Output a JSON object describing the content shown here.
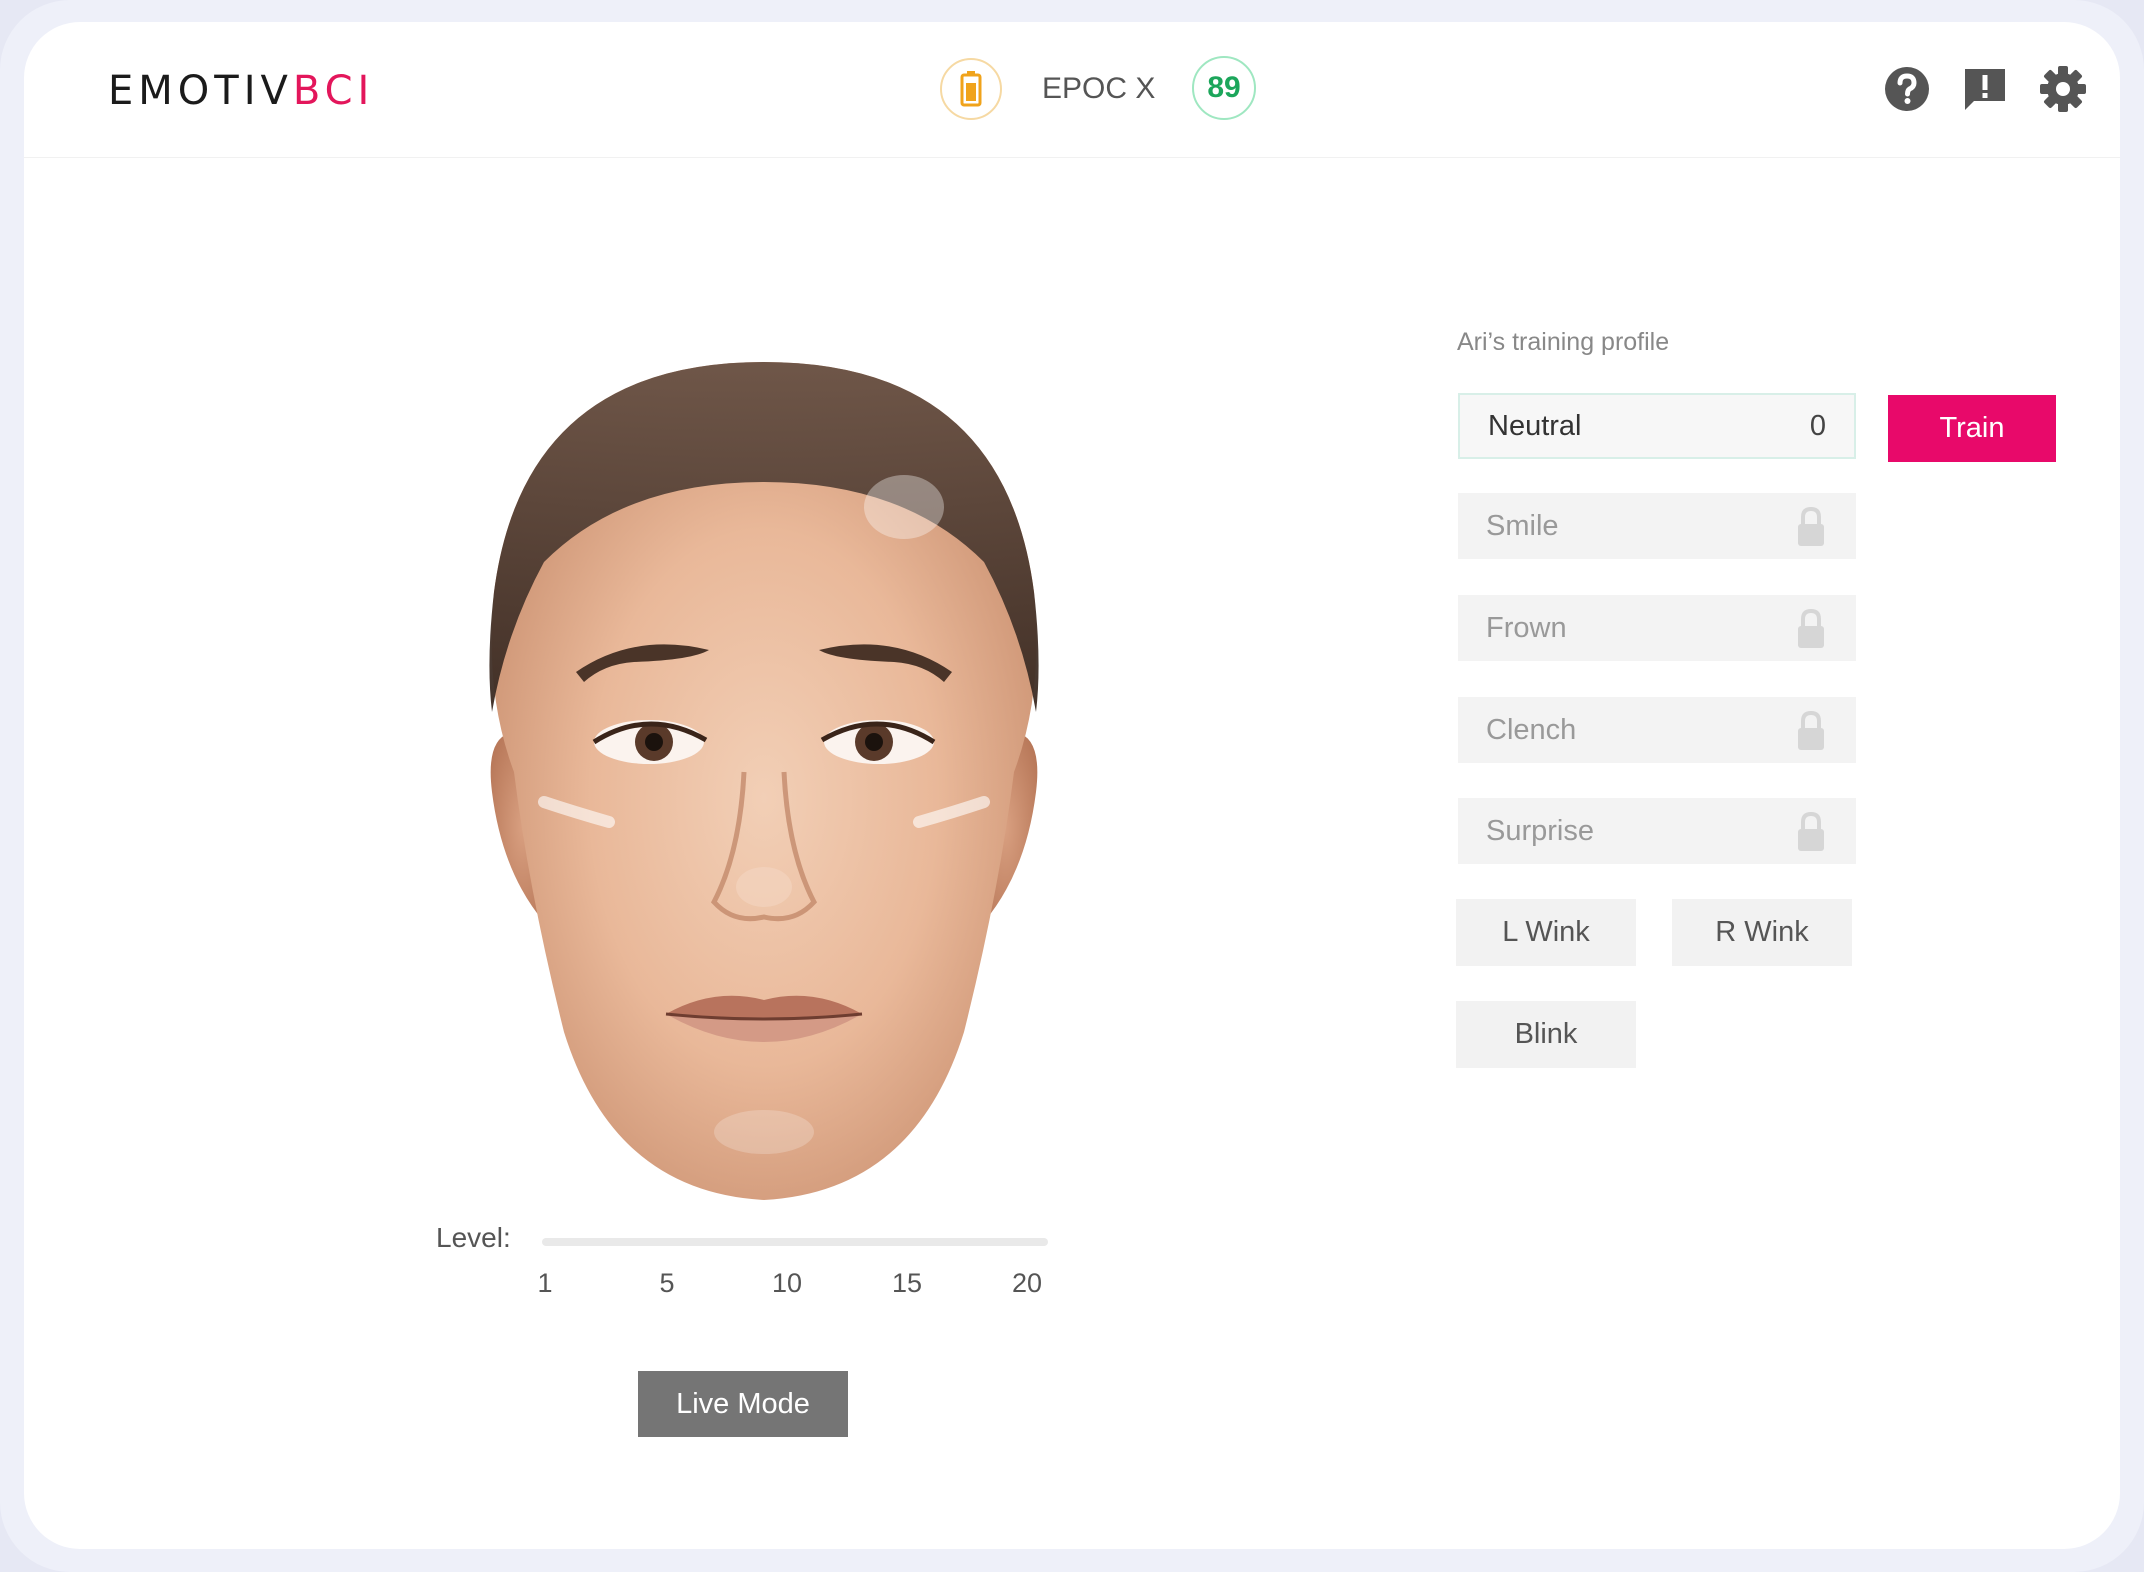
{
  "header": {
    "logo_main": "EMOTIV",
    "logo_accent": "BCI",
    "device_name": "EPOC X",
    "contact_quality": "89",
    "battery_icon": "battery-icon",
    "help_icon": "help-icon",
    "feedback_icon": "feedback-icon",
    "settings_icon": "gear-icon"
  },
  "face": {
    "level_label": "Level:",
    "level_ticks": [
      "1",
      "5",
      "10",
      "15",
      "20"
    ],
    "level_value": 1,
    "live_mode_label": "Live Mode"
  },
  "panel": {
    "profile_label": "Ari’s training profile",
    "active_item": {
      "name": "Neutral",
      "count": "0"
    },
    "train_label": "Train",
    "locked_items": [
      "Smile",
      "Frown",
      "Clench",
      "Surprise"
    ],
    "actions": [
      "L Wink",
      "R Wink",
      "Blink"
    ]
  },
  "colors": {
    "brand_accent": "#e3165b",
    "train_button": "#e8096a",
    "quality_green": "#1ca65b",
    "battery_orange": "#f0a31b"
  }
}
